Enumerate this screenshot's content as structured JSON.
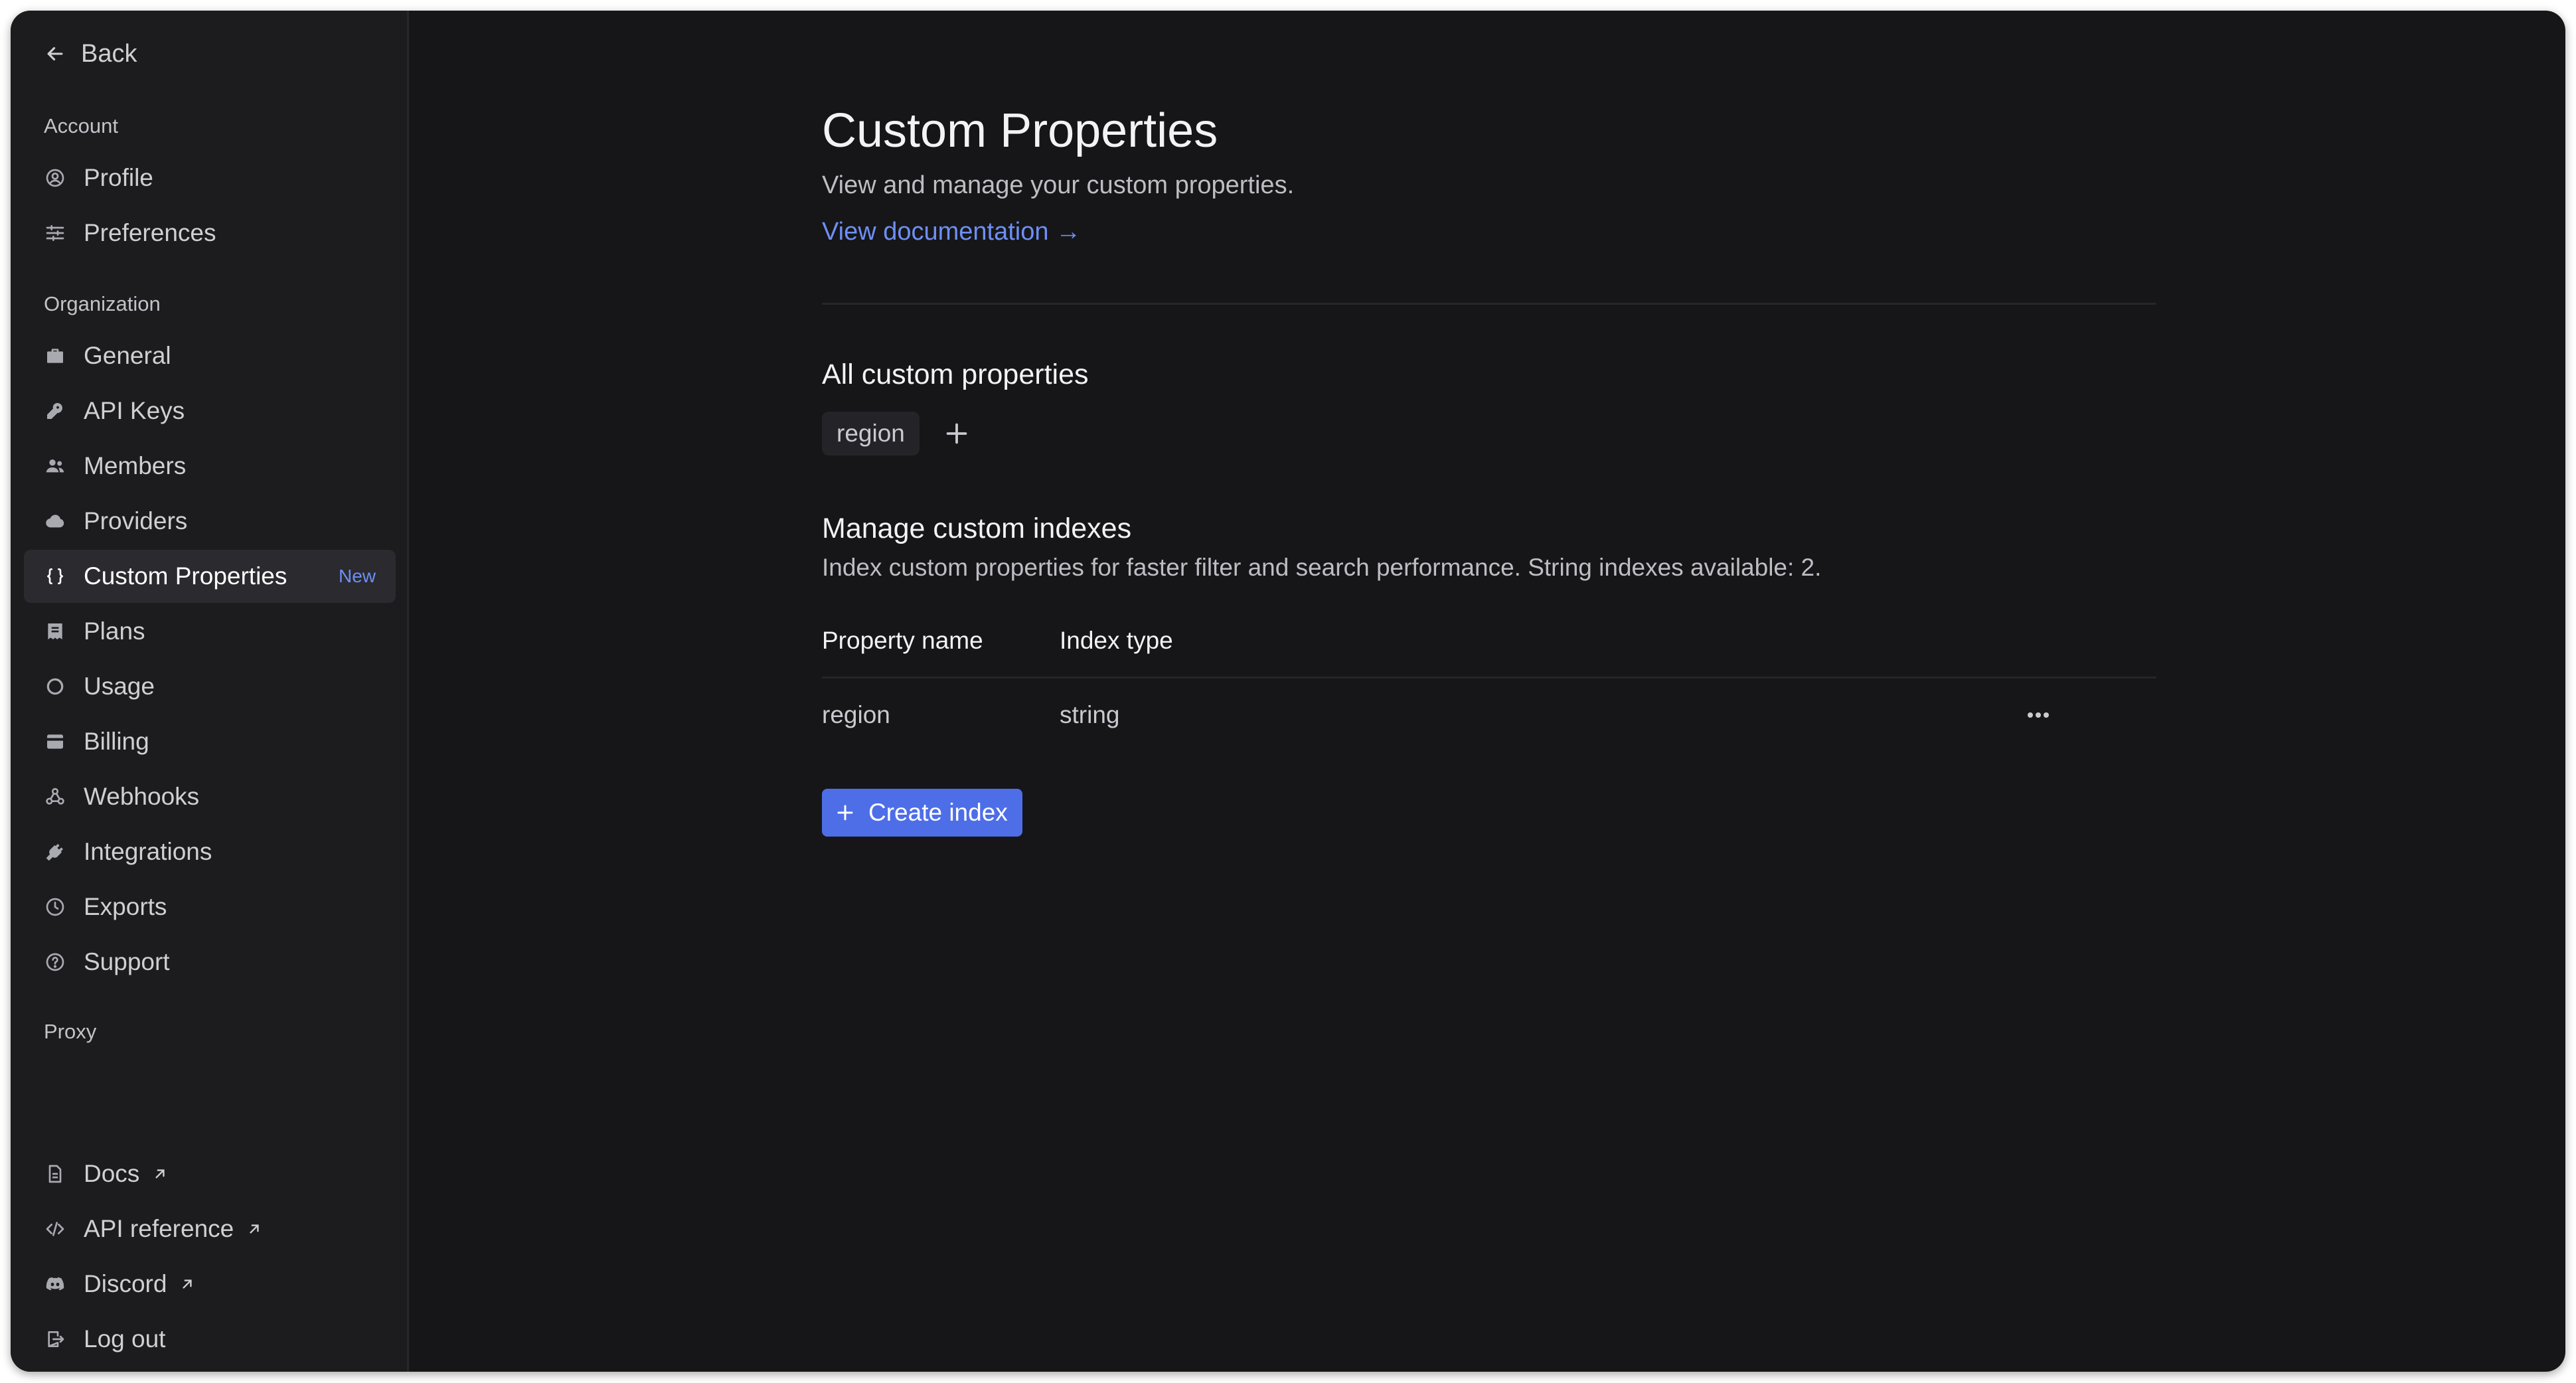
{
  "sidebar": {
    "back_label": "Back",
    "sections": {
      "account": "Account",
      "organization": "Organization",
      "proxy": "Proxy"
    },
    "items": {
      "profile": "Profile",
      "preferences": "Preferences",
      "general": "General",
      "api_keys": "API Keys",
      "members": "Members",
      "providers": "Providers",
      "custom_properties": "Custom Properties",
      "custom_properties_badge": "New",
      "plans": "Plans",
      "usage": "Usage",
      "billing": "Billing",
      "webhooks": "Webhooks",
      "integrations": "Integrations",
      "exports": "Exports",
      "support": "Support"
    },
    "footer": {
      "docs": "Docs",
      "api_reference": "API reference",
      "discord": "Discord",
      "logout": "Log out"
    }
  },
  "main": {
    "title": "Custom Properties",
    "subtitle": "View and manage your custom properties.",
    "doc_link": "View documentation →",
    "all_props_heading": "All custom properties",
    "properties": [
      "region"
    ],
    "indexes_heading": "Manage custom indexes",
    "indexes_description": "Index custom properties for faster filter and search performance. String indexes available: 2.",
    "table": {
      "headers": [
        "Property name",
        "Index type"
      ],
      "rows": [
        {
          "property_name": "region",
          "index_type": "string"
        }
      ]
    },
    "create_button": "Create index"
  },
  "colors": {
    "accent": "#4e6ee8",
    "link": "#6e8ff5",
    "background": "#161618",
    "sidebar": "#1c1c1f"
  }
}
